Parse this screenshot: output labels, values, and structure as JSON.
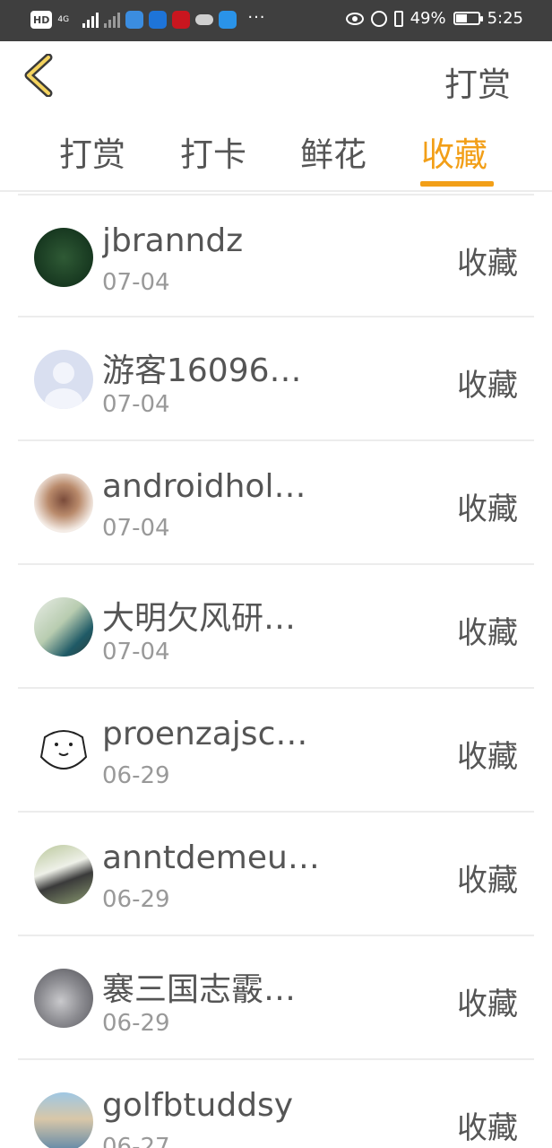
{
  "status_bar": {
    "hd": "HD",
    "network": "4G",
    "battery_text": "49%",
    "battery_level": 0.49,
    "time": "5:25",
    "more": "···"
  },
  "header": {
    "back_icon": "chevron-left-icon",
    "action_label": "打赏"
  },
  "tabs": [
    {
      "label": "打赏",
      "active": false
    },
    {
      "label": "打卡",
      "active": false
    },
    {
      "label": "鲜花",
      "active": false
    },
    {
      "label": "收藏",
      "active": true
    }
  ],
  "accent_color": "#f29f18",
  "list": [
    {
      "name": "jbranndz",
      "date": "07-04",
      "action": "收藏"
    },
    {
      "name": "游客16096…",
      "date": "07-04",
      "action": "收藏"
    },
    {
      "name": "androidhol…",
      "date": "07-04",
      "action": "收藏"
    },
    {
      "name": "大明欠风研…",
      "date": "07-04",
      "action": "收藏"
    },
    {
      "name": "proenzajsc…",
      "date": "06-29",
      "action": "收藏"
    },
    {
      "name": "anntdemeu…",
      "date": "06-29",
      "action": "收藏"
    },
    {
      "name": "褰三国志霰…",
      "date": "06-29",
      "action": "收藏"
    },
    {
      "name": "golfbtuddsy",
      "date": "06-27",
      "action": "收藏"
    }
  ]
}
